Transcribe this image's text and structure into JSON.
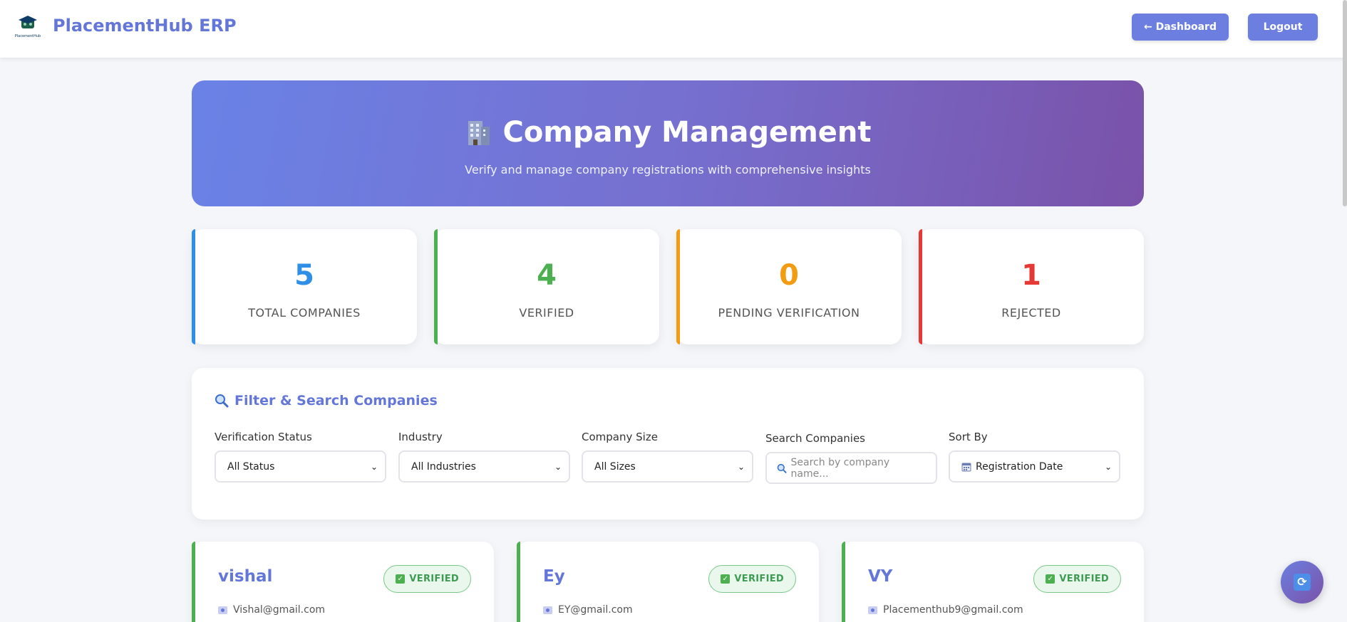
{
  "header": {
    "brand": "PlacementHub ERP",
    "logo_text": "PlacementHub",
    "dashboard_label": "← Dashboard",
    "logout_label": "Logout"
  },
  "hero": {
    "title": "Company Management",
    "subtitle": "Verify and manage company registrations with comprehensive insights",
    "icon": "office-building-icon"
  },
  "stats": [
    {
      "value": "5",
      "label": "TOTAL COMPANIES",
      "color": "#2f8fe6"
    },
    {
      "value": "4",
      "label": "VERIFIED",
      "color": "#4caf50"
    },
    {
      "value": "0",
      "label": "PENDING VERIFICATION",
      "color": "#f39c12"
    },
    {
      "value": "1",
      "label": "REJECTED",
      "color": "#e53935"
    }
  ],
  "filters": {
    "title": "Filter & Search Companies",
    "status": {
      "label": "Verification Status",
      "value": "All Status"
    },
    "industry": {
      "label": "Industry",
      "value": "All Industries"
    },
    "size": {
      "label": "Company Size",
      "value": "All Sizes"
    },
    "search": {
      "label": "Search Companies",
      "placeholder": "Search by company name..."
    },
    "sort": {
      "label": "Sort By",
      "value": "Registration Date"
    }
  },
  "companies": [
    {
      "name": "vishal",
      "status": "VERIFIED",
      "email": "Vishal@gmail.com"
    },
    {
      "name": "Ey",
      "status": "VERIFIED",
      "email": "EY@gmail.com"
    },
    {
      "name": "VY",
      "status": "VERIFIED",
      "email": "Placementhub9@gmail.com"
    }
  ],
  "colors": {
    "accent": "#6477d9",
    "button": "#6c7fe0",
    "verified": "#4caf50"
  }
}
